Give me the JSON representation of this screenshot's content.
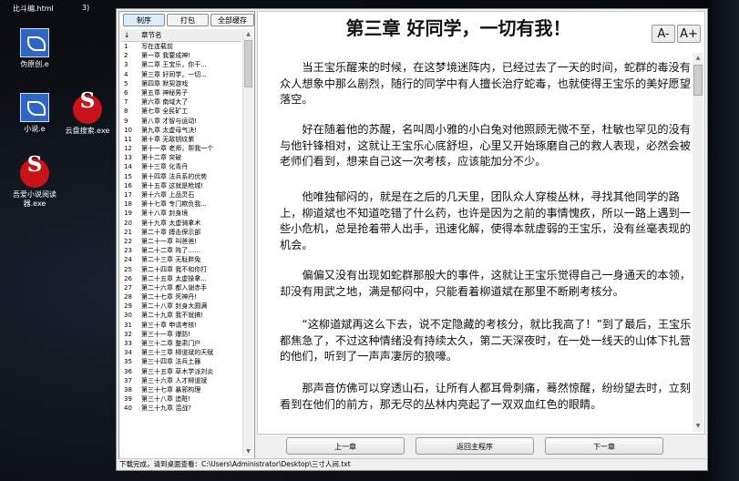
{
  "desktop": {
    "top_labels": [
      "比斗编.html",
      "3)"
    ],
    "icons": [
      {
        "label": "伪原创.e"
      },
      {
        "label": "小说.e"
      },
      {
        "label": "云盘搜索.exe"
      },
      {
        "label": "吾爱小说阅读器.exe"
      }
    ]
  },
  "sidebar": {
    "tabs": [
      "制序",
      "打包",
      "全部缓存"
    ],
    "header": {
      "index": "↓",
      "name": "章节名"
    },
    "chapters": [
      {
        "n": "1",
        "t": "写在连载前"
      },
      {
        "n": "2",
        "t": "第一章  我要成神!"
      },
      {
        "n": "3",
        "t": "第二章  王宝乐，你干..."
      },
      {
        "n": "4",
        "t": "第三章  好同学，一切..."
      },
      {
        "n": "5",
        "t": "第四章  默契游戏"
      },
      {
        "n": "6",
        "t": "第五章  神秘男子"
      },
      {
        "n": "7",
        "t": "第六章  南域大了"
      },
      {
        "n": "8",
        "t": "第七章  全民矿工"
      },
      {
        "n": "9",
        "t": "第八章  才智与运动!"
      },
      {
        "n": "10",
        "t": "第九章  太虚母气决!"
      },
      {
        "n": "11",
        "t": "第十章  无敌钥纹紫"
      },
      {
        "n": "12",
        "t": "第十一章  老师，帮我一个"
      },
      {
        "n": "13",
        "t": "第十二章  突破"
      },
      {
        "n": "14",
        "t": "第十三章  化青丹"
      },
      {
        "n": "15",
        "t": "第十四章  法兵系的优势"
      },
      {
        "n": "16",
        "t": "第十五章  这就是枪城!"
      },
      {
        "n": "17",
        "t": "第十六章  上品灵石"
      },
      {
        "n": "18",
        "t": "第十七章  专门欺负我..."
      },
      {
        "n": "19",
        "t": "第十八章  封身境"
      },
      {
        "n": "20",
        "t": "第十九章  太虚骑拿术"
      },
      {
        "n": "21",
        "t": "第二十章  搏击保示部"
      },
      {
        "n": "22",
        "t": "第二十一章  叫爸爸!"
      },
      {
        "n": "23",
        "t": "第二十二章  阵了……"
      },
      {
        "n": "24",
        "t": "第二十三章  无耻胖兔"
      },
      {
        "n": "25",
        "t": "第二十四章  我不和你打"
      },
      {
        "n": "26",
        "t": "第二十五章  太虚操拿..."
      },
      {
        "n": "27",
        "t": "第二十六章  都入谢赤手"
      },
      {
        "n": "28",
        "t": "第二十七章  死神丹!"
      },
      {
        "n": "29",
        "t": "第二十八章  封身大圆满"
      },
      {
        "n": "30",
        "t": "第二十九章  我不就搞!"
      },
      {
        "n": "31",
        "t": "第三十章  申请考核!"
      },
      {
        "n": "32",
        "t": "第三十一章  爆防!"
      },
      {
        "n": "33",
        "t": "第三十二章  整肃门户"
      },
      {
        "n": "34",
        "t": "第三十三章  柳道斌的天赋"
      },
      {
        "n": "35",
        "t": "第三十四章  法兵土器"
      },
      {
        "n": "36",
        "t": "第三十五章  草木学派刘炎"
      },
      {
        "n": "37",
        "t": "第三十六章  人才柳道斌"
      },
      {
        "n": "38",
        "t": "第三十七章  暴邪构理"
      },
      {
        "n": "39",
        "t": "第三十八章  追赃!"
      },
      {
        "n": "40",
        "t": "第三十九章  混战?"
      }
    ]
  },
  "reader": {
    "title": "第三章  好同学，一切有我！",
    "font_decrease": "A-",
    "font_increase": "A+",
    "paragraphs": [
      "当王宝乐醒来的时候，在这梦境迷阵内，已经过去了一天的时间，蛇群的毒没有众人想象中那么剧烈，随行的同学中有人擅长治疗蛇毒，也就使得王宝乐的美好愿望落空。",
      "好在随着他的苏醒，名叫周小雅的小白兔对他照顾无微不至，杜敏也罕见的没有与他针锋相对，这就让王宝乐心底舒坦，心里又开始琢磨自己的救人表现，必然会被老师们看到，想来自己这一次考核，应该能加分不少。",
      "他唯独郁闷的，就是在之后的几天里，团队众人穿梭丛林，寻找其他同学的路上，柳道斌也不知道吃错了什么药，也许是因为之前的事情愧疚，所以一路上遇到一些小危机，总是抢着带人出手，迅速化解，使得本就虚弱的王宝乐，没有丝毫表现的机会。",
      "偏偏又没有出现如蛇群那般大的事件，这就让王宝乐觉得自己一身通天的本领，却没有用武之地，满是郁闷中，只能看着柳道斌在那里不断刷考核分。",
      "“这柳道斌再这么下去，说不定隐藏的考核分，就比我高了！”到了最后，王宝乐都焦急了，不过这种情绪没有持续太久，第二天深夜时，在一处一线天的山体下扎营的他们，听到了一声声凄厉的狼嚎。",
      "那声音仿佛可以穿透山石，让所有人都耳骨刺痛，蓦然惊醒，纷纷望去时，立刻看到在他们的前方，那无尽的丛林内亮起了一双双血红色的眼睛。"
    ],
    "nav": {
      "prev": "上一章",
      "home": "返回主程序",
      "next": "下一章"
    }
  },
  "status": {
    "text": "下载完成，请到桌面查看：C:\\Users\\Administrator\\Desktop\\三寸人间.txt"
  }
}
